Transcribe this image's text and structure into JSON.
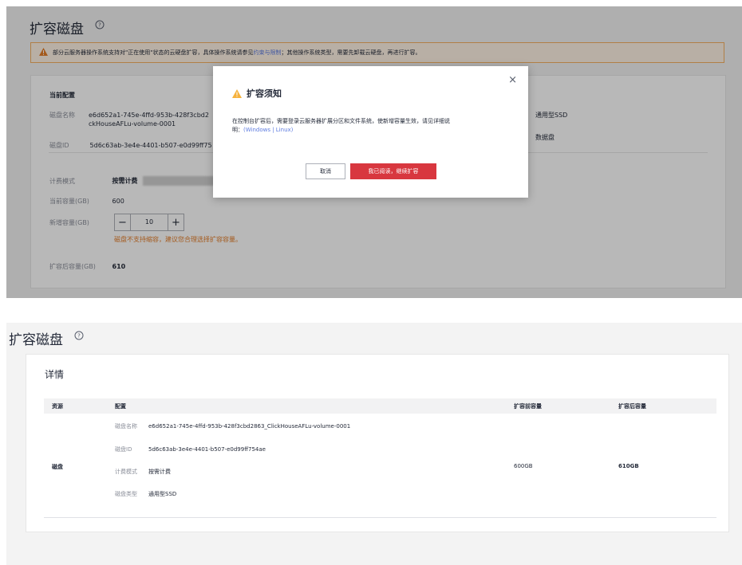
{
  "top": {
    "title": "扩容磁盘",
    "warning": {
      "before_link": "部分云服务器操作系统支持对\"正在使用\"状态的云硬盘扩容，具体操作系统请参见",
      "link": "约束与限制",
      "after_link": "；其他操作系统类型，需要先卸载云硬盘，再进行扩容。"
    },
    "current_config": {
      "section_title": "当前配置",
      "disk_name_label": "磁盘名称",
      "disk_name_line1": "e6d652a1-745e-4ffd-953b-428f3cbd2",
      "disk_name_line2": "ckHouseAFLu-volume-0001",
      "disk_id_label": "磁盘ID",
      "disk_id_value": "5d6c63ab-3e4e-4401-b507-e0d99ff75",
      "disk_type_value": "通用型SSD",
      "disk_mode_value": "数据盘"
    },
    "billing_label": "计费模式",
    "billing_value": "按需计费",
    "current_cap_label": "当前容量(GB)",
    "current_cap_value": "600",
    "add_cap_label": "新增容量(GB)",
    "add_cap_value": "10",
    "minus": "−",
    "plus": "+",
    "shrink_tip": "磁盘不支持缩容，建议您合理选择扩容容量。",
    "after_cap_label": "扩容后容量(GB)",
    "after_cap_value": "610"
  },
  "modal": {
    "title": "扩容须知",
    "close": "×",
    "body_line1": "在控制台扩容后，需要登录云服务器扩展分区和文件系统，使新增容量生效，请见详细说",
    "body_line2_prefix": "明：",
    "links": "(Windows | Linux)",
    "cancel": "取消",
    "confirm": "我已阅读，继续扩容"
  },
  "bottom": {
    "title": "扩容磁盘",
    "section_title": "详情",
    "headers": {
      "resource": "资源",
      "config": "配置",
      "before": "扩容前容量",
      "after": "扩容后容量"
    },
    "resource": "磁盘",
    "rows": [
      {
        "k": "磁盘名称",
        "v": "e6d652a1-745e-4ffd-953b-428f3cbd2863_ClickHouseAFLu-volume-0001"
      },
      {
        "k": "磁盘ID",
        "v": "5d6c63ab-3e4e-4401-b507-e0d99ff754ae"
      },
      {
        "k": "计费模式",
        "v": "按需计费"
      },
      {
        "k": "磁盘类型",
        "v": "通用型SSD"
      }
    ],
    "before_value": "600GB",
    "after_value": "610GB"
  },
  "colors": {
    "primary_red": "#d8373f",
    "link_blue": "#5e7ce0",
    "warn_orange": "#e37d29"
  }
}
